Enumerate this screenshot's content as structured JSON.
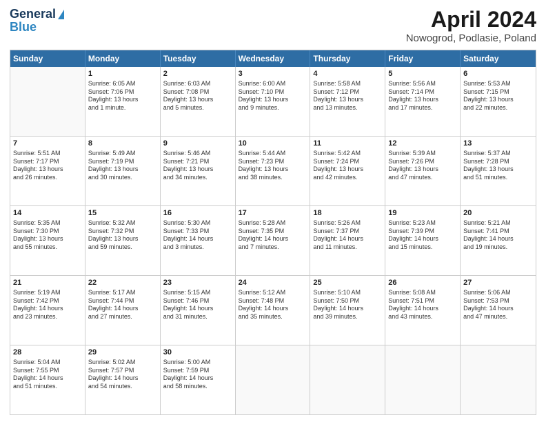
{
  "header": {
    "logo_line1": "General",
    "logo_line2": "Blue",
    "title": "April 2024",
    "subtitle": "Nowogrod, Podlasie, Poland"
  },
  "days_of_week": [
    "Sunday",
    "Monday",
    "Tuesday",
    "Wednesday",
    "Thursday",
    "Friday",
    "Saturday"
  ],
  "weeks": [
    [
      {
        "day": "",
        "empty": true
      },
      {
        "day": "1",
        "info": "Sunrise: 6:05 AM\nSunset: 7:06 PM\nDaylight: 13 hours\nand 1 minute."
      },
      {
        "day": "2",
        "info": "Sunrise: 6:03 AM\nSunset: 7:08 PM\nDaylight: 13 hours\nand 5 minutes."
      },
      {
        "day": "3",
        "info": "Sunrise: 6:00 AM\nSunset: 7:10 PM\nDaylight: 13 hours\nand 9 minutes."
      },
      {
        "day": "4",
        "info": "Sunrise: 5:58 AM\nSunset: 7:12 PM\nDaylight: 13 hours\nand 13 minutes."
      },
      {
        "day": "5",
        "info": "Sunrise: 5:56 AM\nSunset: 7:14 PM\nDaylight: 13 hours\nand 17 minutes."
      },
      {
        "day": "6",
        "info": "Sunrise: 5:53 AM\nSunset: 7:15 PM\nDaylight: 13 hours\nand 22 minutes."
      }
    ],
    [
      {
        "day": "7",
        "info": "Sunrise: 5:51 AM\nSunset: 7:17 PM\nDaylight: 13 hours\nand 26 minutes."
      },
      {
        "day": "8",
        "info": "Sunrise: 5:49 AM\nSunset: 7:19 PM\nDaylight: 13 hours\nand 30 minutes."
      },
      {
        "day": "9",
        "info": "Sunrise: 5:46 AM\nSunset: 7:21 PM\nDaylight: 13 hours\nand 34 minutes."
      },
      {
        "day": "10",
        "info": "Sunrise: 5:44 AM\nSunset: 7:23 PM\nDaylight: 13 hours\nand 38 minutes."
      },
      {
        "day": "11",
        "info": "Sunrise: 5:42 AM\nSunset: 7:24 PM\nDaylight: 13 hours\nand 42 minutes."
      },
      {
        "day": "12",
        "info": "Sunrise: 5:39 AM\nSunset: 7:26 PM\nDaylight: 13 hours\nand 47 minutes."
      },
      {
        "day": "13",
        "info": "Sunrise: 5:37 AM\nSunset: 7:28 PM\nDaylight: 13 hours\nand 51 minutes."
      }
    ],
    [
      {
        "day": "14",
        "info": "Sunrise: 5:35 AM\nSunset: 7:30 PM\nDaylight: 13 hours\nand 55 minutes."
      },
      {
        "day": "15",
        "info": "Sunrise: 5:32 AM\nSunset: 7:32 PM\nDaylight: 13 hours\nand 59 minutes."
      },
      {
        "day": "16",
        "info": "Sunrise: 5:30 AM\nSunset: 7:33 PM\nDaylight: 14 hours\nand 3 minutes."
      },
      {
        "day": "17",
        "info": "Sunrise: 5:28 AM\nSunset: 7:35 PM\nDaylight: 14 hours\nand 7 minutes."
      },
      {
        "day": "18",
        "info": "Sunrise: 5:26 AM\nSunset: 7:37 PM\nDaylight: 14 hours\nand 11 minutes."
      },
      {
        "day": "19",
        "info": "Sunrise: 5:23 AM\nSunset: 7:39 PM\nDaylight: 14 hours\nand 15 minutes."
      },
      {
        "day": "20",
        "info": "Sunrise: 5:21 AM\nSunset: 7:41 PM\nDaylight: 14 hours\nand 19 minutes."
      }
    ],
    [
      {
        "day": "21",
        "info": "Sunrise: 5:19 AM\nSunset: 7:42 PM\nDaylight: 14 hours\nand 23 minutes."
      },
      {
        "day": "22",
        "info": "Sunrise: 5:17 AM\nSunset: 7:44 PM\nDaylight: 14 hours\nand 27 minutes."
      },
      {
        "day": "23",
        "info": "Sunrise: 5:15 AM\nSunset: 7:46 PM\nDaylight: 14 hours\nand 31 minutes."
      },
      {
        "day": "24",
        "info": "Sunrise: 5:12 AM\nSunset: 7:48 PM\nDaylight: 14 hours\nand 35 minutes."
      },
      {
        "day": "25",
        "info": "Sunrise: 5:10 AM\nSunset: 7:50 PM\nDaylight: 14 hours\nand 39 minutes."
      },
      {
        "day": "26",
        "info": "Sunrise: 5:08 AM\nSunset: 7:51 PM\nDaylight: 14 hours\nand 43 minutes."
      },
      {
        "day": "27",
        "info": "Sunrise: 5:06 AM\nSunset: 7:53 PM\nDaylight: 14 hours\nand 47 minutes."
      }
    ],
    [
      {
        "day": "28",
        "info": "Sunrise: 5:04 AM\nSunset: 7:55 PM\nDaylight: 14 hours\nand 51 minutes."
      },
      {
        "day": "29",
        "info": "Sunrise: 5:02 AM\nSunset: 7:57 PM\nDaylight: 14 hours\nand 54 minutes."
      },
      {
        "day": "30",
        "info": "Sunrise: 5:00 AM\nSunset: 7:59 PM\nDaylight: 14 hours\nand 58 minutes."
      },
      {
        "day": "",
        "empty": true
      },
      {
        "day": "",
        "empty": true
      },
      {
        "day": "",
        "empty": true
      },
      {
        "day": "",
        "empty": true
      }
    ]
  ]
}
